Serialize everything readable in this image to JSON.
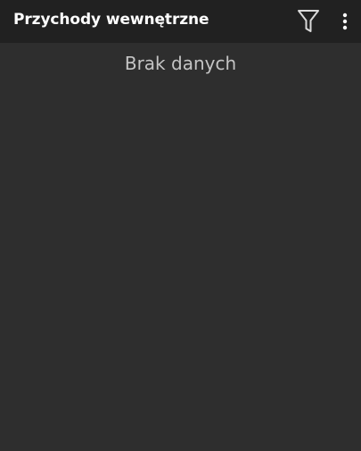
{
  "toolbar": {
    "title": "Przychody wewnętrzne",
    "filter_icon": "filter-icon",
    "overflow_icon": "more-vertical-icon"
  },
  "content": {
    "empty_message": "Brak danych"
  },
  "colors": {
    "toolbar_background": "#212121",
    "content_background": "#2e2e2e",
    "title_text": "#ffffff",
    "empty_text": "#c4c4c4",
    "icon": "#d9d9d9"
  }
}
